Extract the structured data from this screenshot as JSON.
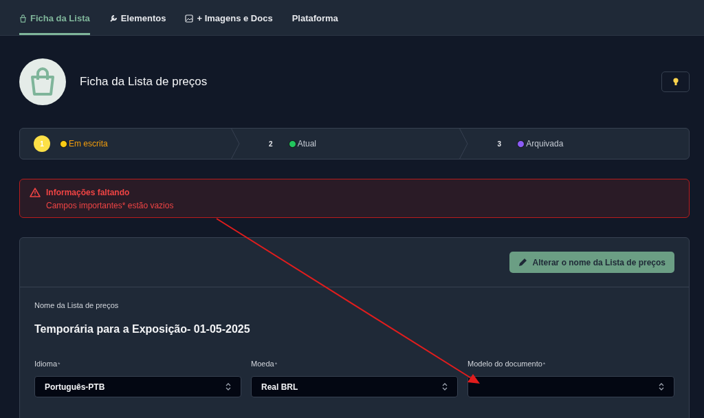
{
  "tabs": [
    {
      "label": "Ficha da Lista",
      "selected": true
    },
    {
      "label": "Elementos",
      "selected": false
    },
    {
      "label": "+ Imagens e Docs",
      "selected": false
    },
    {
      "label": "Plataforma",
      "selected": false
    }
  ],
  "header": {
    "title": "Ficha da Lista de preços"
  },
  "steps": [
    {
      "number": "1",
      "label": "Em escrita",
      "color": "#facc15",
      "selected": true
    },
    {
      "number": "2",
      "label": "Atual",
      "color": "#22c55e",
      "selected": false
    },
    {
      "number": "3",
      "label": "Arquivada",
      "color": "#8b5cf6",
      "selected": false
    }
  ],
  "alert": {
    "title": "Informações faltando",
    "message": "Campos importantes* estão vazios"
  },
  "card": {
    "rename_button": "Alterar o nome da Lista de preços",
    "name_label": "Nome da Lista de preços",
    "name_value": "Temporária para a Exposição- 01-05-2025",
    "fields": [
      {
        "label": "Idioma",
        "required_mark": "*",
        "value": "Português-PTB"
      },
      {
        "label": "Moeda",
        "required_mark": "*",
        "value": "Real BRL"
      },
      {
        "label": "Modelo do documento",
        "required_mark": "*"
      }
    ]
  }
}
